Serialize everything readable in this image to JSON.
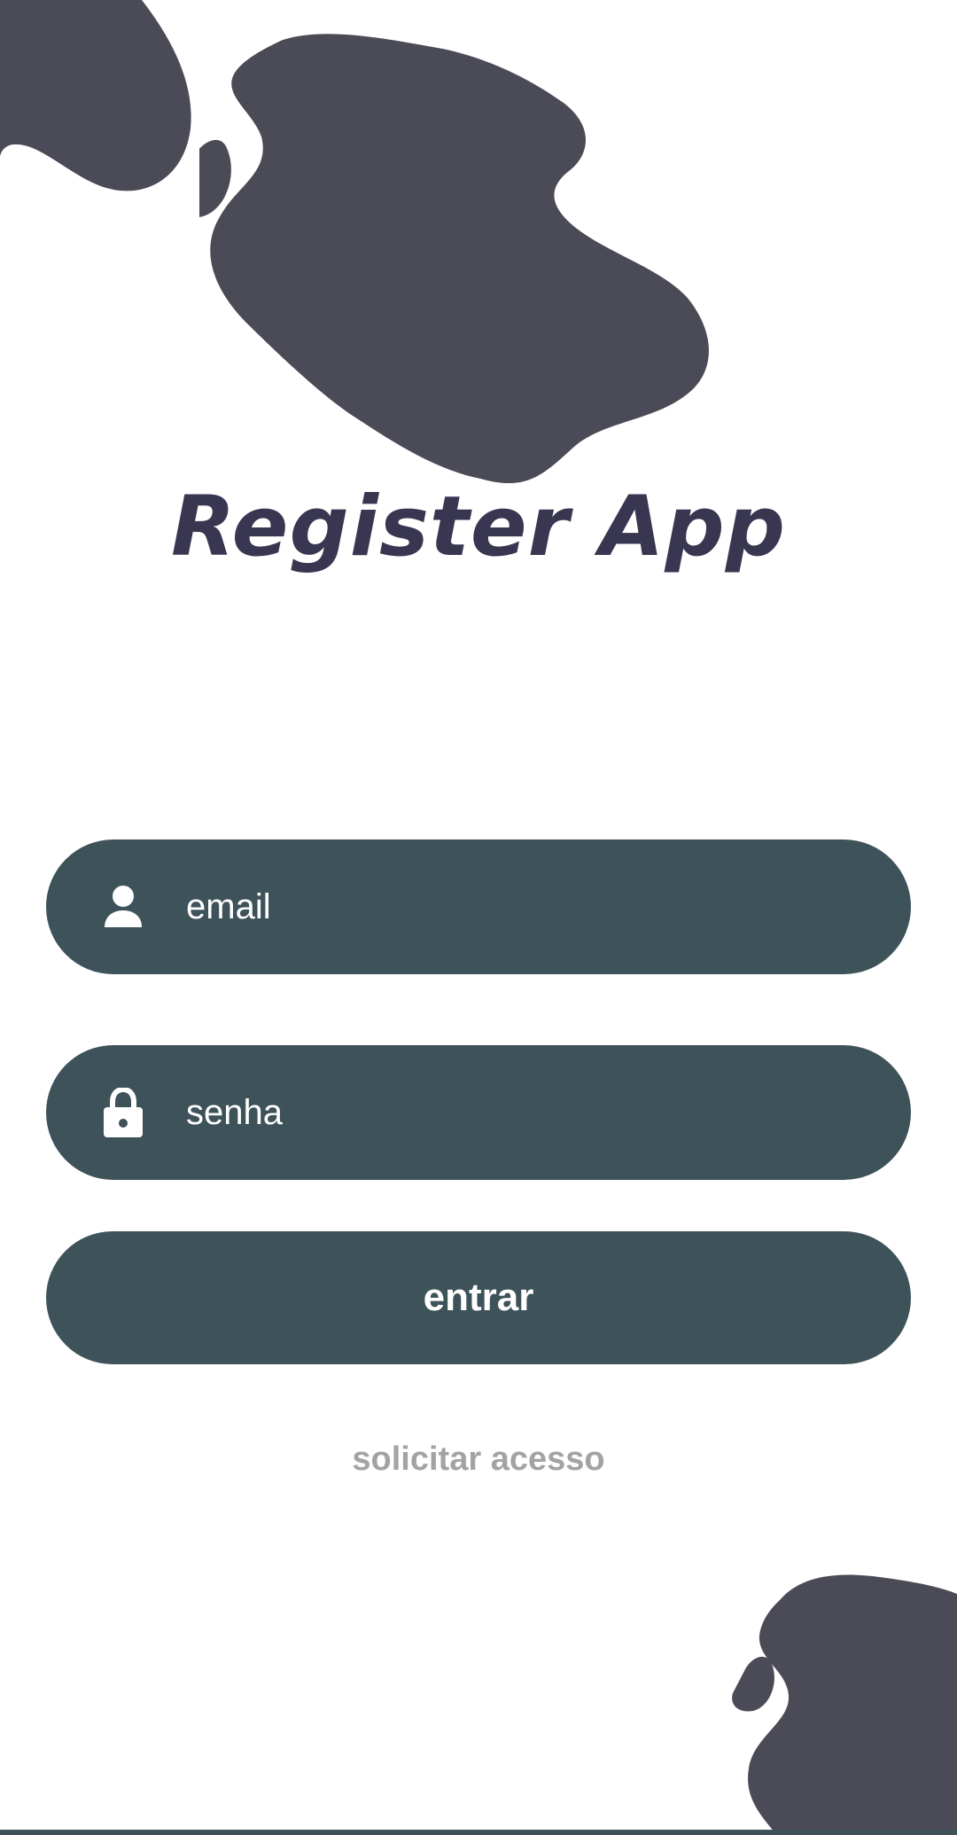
{
  "app": {
    "title": "Register App"
  },
  "form": {
    "email_placeholder": "email",
    "email_icon": "person-icon",
    "password_placeholder": "senha",
    "password_icon": "lock-icon",
    "login_label": "entrar",
    "request_access_label": "solicitar acesso"
  },
  "colors": {
    "blob": "#4b4b58",
    "title": "#383650",
    "input_background": "#3e525a",
    "input_text": "#ffffff",
    "link_text": "#a3a3a3"
  }
}
